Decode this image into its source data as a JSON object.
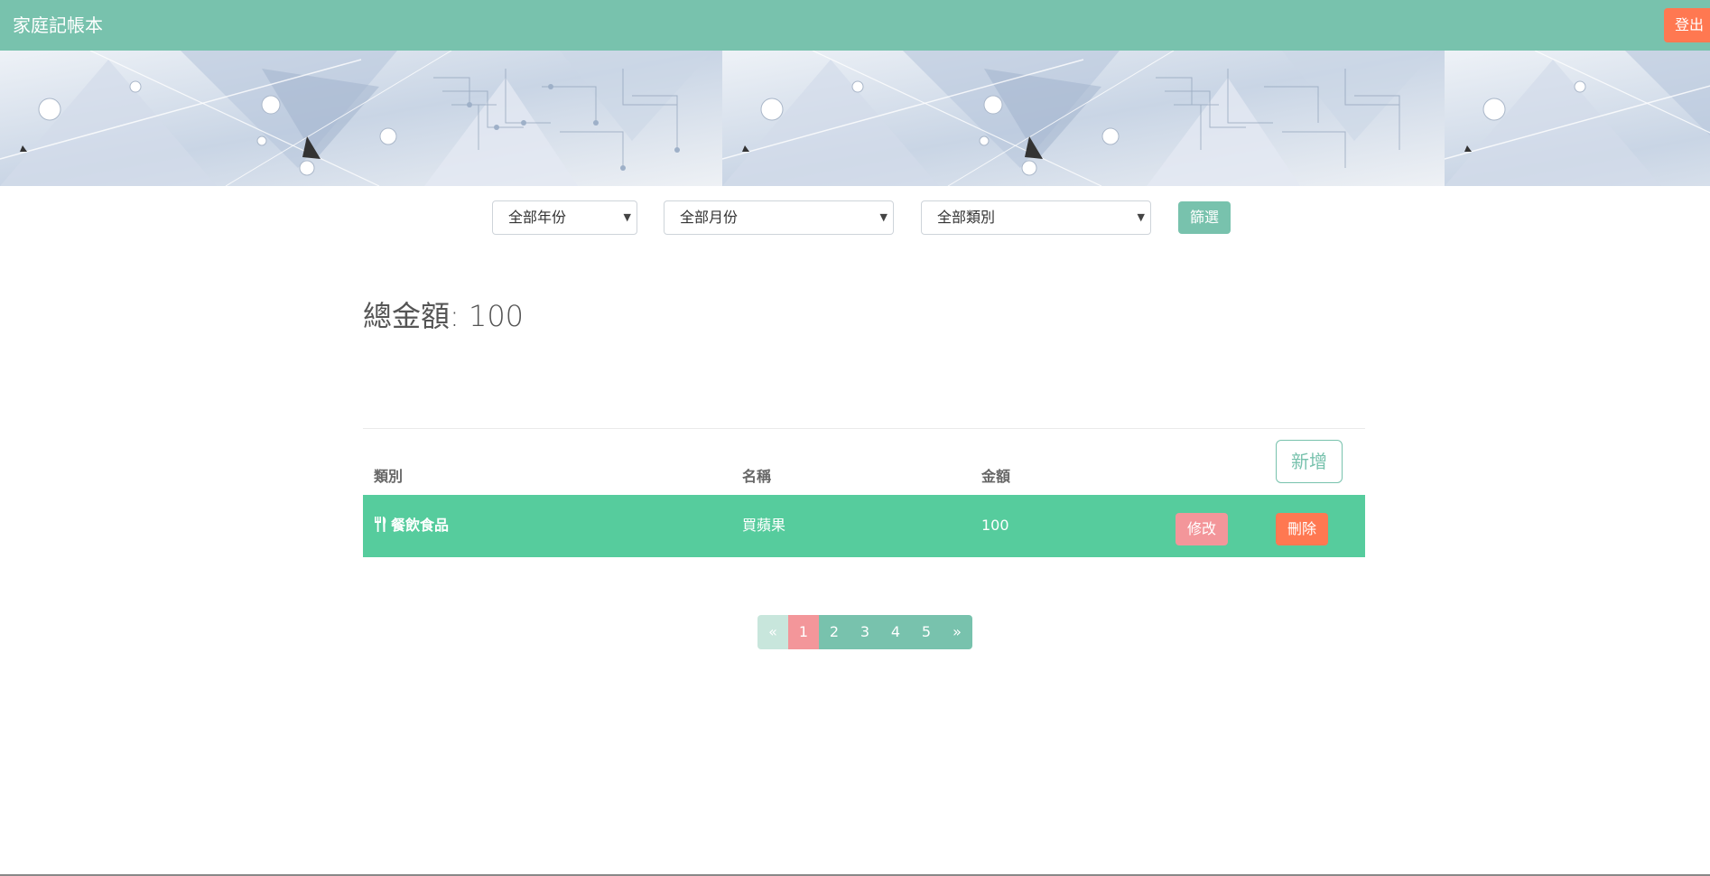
{
  "navbar": {
    "brand": "家庭記帳本",
    "logout_label": "登出",
    "color": "#78c2ad"
  },
  "filters": {
    "year_selected": "全部年份",
    "month_selected": "全部月份",
    "category_selected": "全部類別",
    "submit_label": "篩選"
  },
  "summary": {
    "total_text": "總金額: 100"
  },
  "table": {
    "headers": [
      "類別",
      "名稱",
      "金額"
    ],
    "add_label": "新增",
    "rows": [
      {
        "category_icon": "utensils-icon",
        "category": "餐飲食品",
        "name": "買蘋果",
        "amount": "100",
        "edit_label": "修改",
        "delete_label": "刪除"
      }
    ]
  },
  "pagination": {
    "prev": "«",
    "pages": [
      "1",
      "2",
      "3",
      "4",
      "5"
    ],
    "next": "»",
    "current": "1"
  },
  "colors": {
    "primary": "#78c2ad",
    "success": "#56cc9d",
    "danger": "#ff7851",
    "secondary": "#f3969a"
  }
}
